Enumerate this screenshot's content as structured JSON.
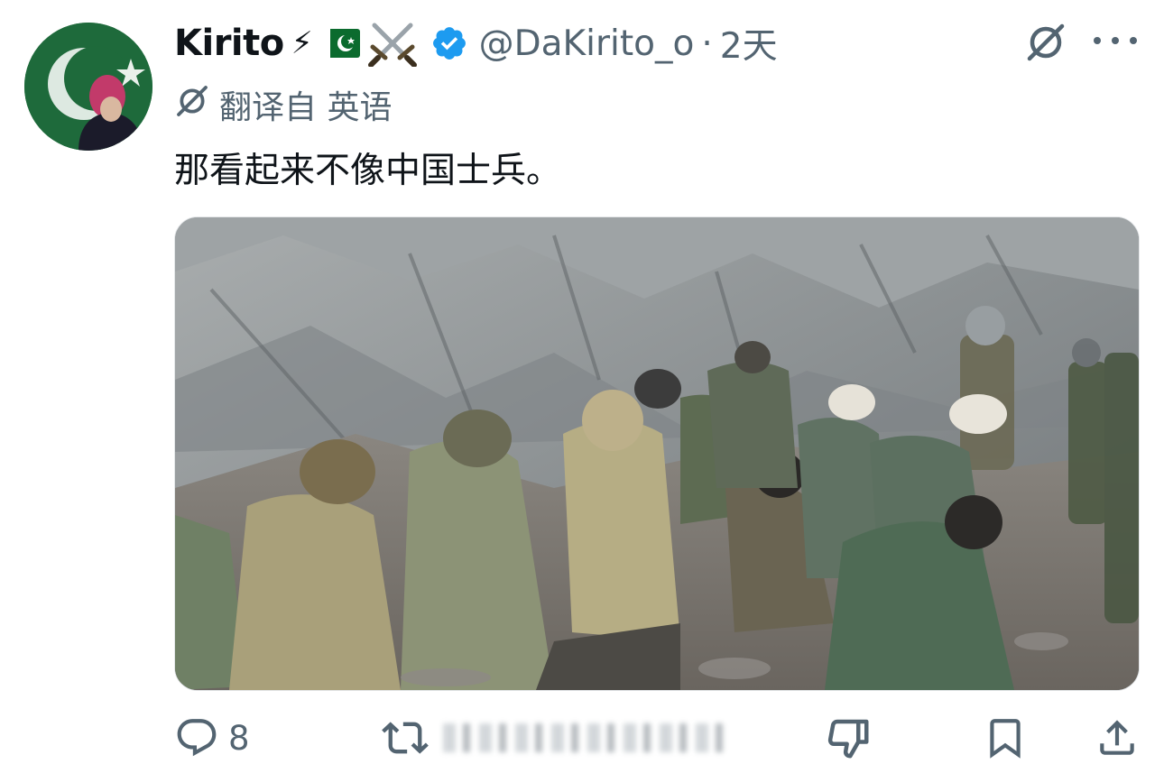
{
  "tweet": {
    "author": {
      "display_name": "Kirito",
      "emoji": [
        "⚡",
        "🇵🇰",
        "⚔️"
      ],
      "handle": "@DaKirito_o",
      "verified": true,
      "avatar_icon": "avatar-image"
    },
    "separator": "·",
    "time": "2天",
    "translated_label": "翻译自 英语",
    "text": "那看起来不像中国士兵。",
    "media": {
      "alt_icon": "photo-soldiers-kneeling-on-rocky-slope"
    },
    "actions": {
      "reply_count": "8",
      "retweet_count": "",
      "like_count": ""
    }
  },
  "colors": {
    "text_primary": "#0f1419",
    "text_secondary": "#536471",
    "verified_blue": "#1d9bf0",
    "background": "#ffffff"
  },
  "icons": [
    "grok-icon",
    "more-icon",
    "translate-icon",
    "verified-badge-icon",
    "reply-icon",
    "retweet-icon",
    "like-icon",
    "bookmark-icon",
    "share-icon"
  ]
}
